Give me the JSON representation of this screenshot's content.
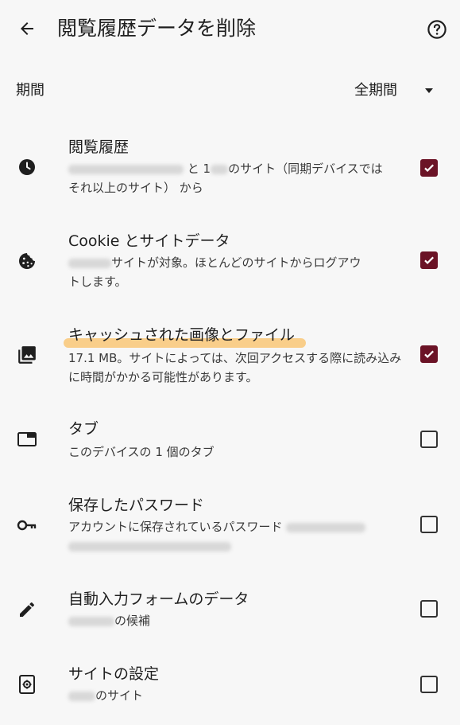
{
  "header": {
    "title": "閲覧履歴データを削除",
    "back_icon": "arrow-left-icon",
    "help_icon": "help-circle-icon"
  },
  "period": {
    "label": "期間",
    "value": "全期間"
  },
  "items": [
    {
      "label": "閲覧履歴",
      "desc_parts": [
        "と 1",
        "のサイト（同期デバイスでは",
        "それ以上",
        "のサイト） から"
      ],
      "checked": true,
      "icon": "clock-icon"
    },
    {
      "label": "Cookie とサイトデータ",
      "desc_parts": [
        "サイトが対象。ほとんどのサイトからログアウ",
        "トします。"
      ],
      "checked": true,
      "icon": "cookie-icon"
    },
    {
      "label": "キャッシュされた画像とファイル",
      "desc": "17.1 MB。サイトによっては、次回アクセスする際に読み込みに時間がかかる可能性があります。",
      "checked": true,
      "icon": "image-icon"
    },
    {
      "label": "タブ",
      "desc": "このデバイスの 1 個のタブ",
      "checked": false,
      "icon": "tab-icon"
    },
    {
      "label": "保存したパスワード",
      "desc_parts": [
        "アカウントに保存されているパスワード"
      ],
      "checked": false,
      "icon": "key-icon"
    },
    {
      "label": "自動入力フォームのデータ",
      "desc_parts": [
        "の候補"
      ],
      "checked": false,
      "icon": "pencil-icon"
    },
    {
      "label": "サイトの設定",
      "desc_parts": [
        "のサイト"
      ],
      "checked": false,
      "icon": "site-settings-icon"
    }
  ],
  "colors": {
    "checkbox_checked": "#6b1326",
    "highlight": "#fab950"
  }
}
